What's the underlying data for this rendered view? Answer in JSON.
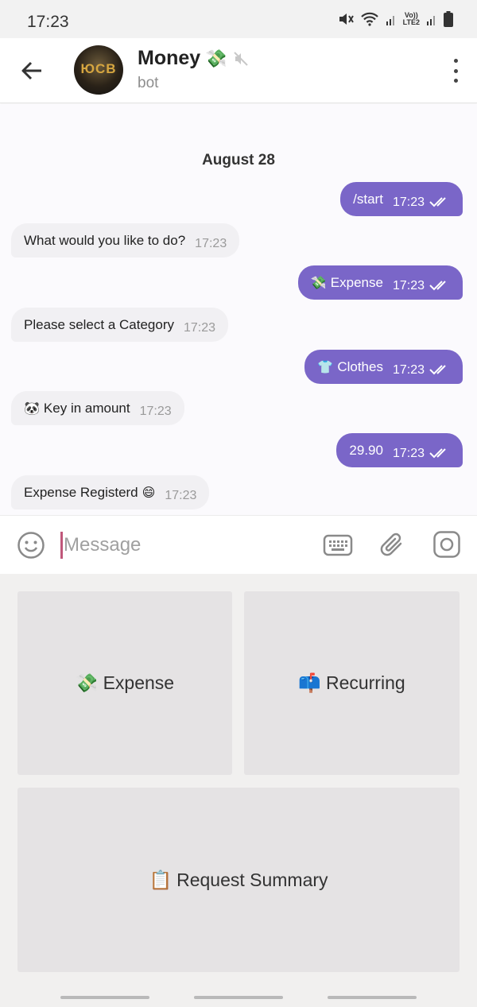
{
  "status_bar": {
    "time": "17:23",
    "network_label": "Vo)) LTE2"
  },
  "header": {
    "title": "Money",
    "title_emoji": "💸",
    "subtitle": "bot",
    "avatar_text": "ЮCB"
  },
  "chat": {
    "date": "August 28",
    "messages": [
      {
        "dir": "out",
        "text": "/start",
        "time": "17:23"
      },
      {
        "dir": "in",
        "text": "What would you like to do?",
        "time": "17:23"
      },
      {
        "dir": "out",
        "emoji": "💸",
        "text": "Expense",
        "time": "17:23"
      },
      {
        "dir": "in",
        "text": "Please select a Category",
        "time": "17:23"
      },
      {
        "dir": "out",
        "emoji": "👕",
        "text": "Clothes",
        "time": "17:23"
      },
      {
        "dir": "in",
        "emoji": "🐼",
        "text": "Key in amount",
        "time": "17:23"
      },
      {
        "dir": "out",
        "text": "29.90",
        "time": "17:23"
      },
      {
        "dir": "in",
        "text": "Expense Registerd",
        "suffix_emoji": "😄",
        "time": "17:23"
      }
    ]
  },
  "composer": {
    "placeholder": "Message"
  },
  "keyboard": {
    "expense": {
      "emoji": "💸",
      "label": "Expense"
    },
    "recurring": {
      "emoji": "📫",
      "label": "Recurring"
    },
    "summary": {
      "emoji": "📋",
      "label": "Request Summary"
    }
  },
  "colors": {
    "outgoing_bubble": "#7a66c8",
    "incoming_bubble": "#f1f0f3",
    "cursor": "#c0577a"
  }
}
